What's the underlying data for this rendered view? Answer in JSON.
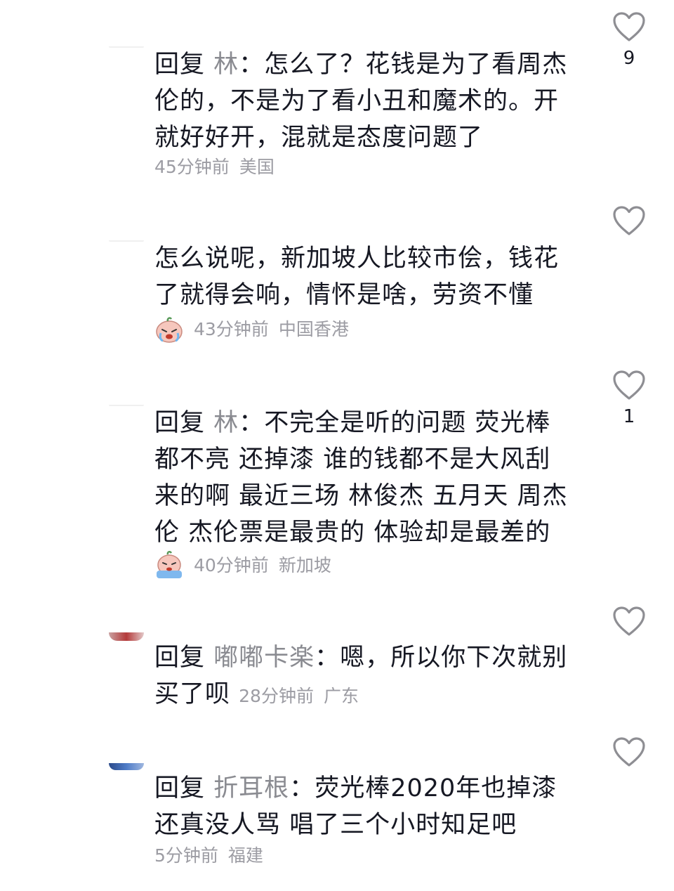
{
  "comments": [
    {
      "reply_word": "回复",
      "reply_to": "林",
      "colon": "：",
      "text": "怎么了？花钱是为了看周杰伦的，不是为了看小丑和魔术的。开就好好开，混就是态度问题了",
      "time": "45分钟前",
      "location": "美国",
      "likes": "9",
      "emoji": null
    },
    {
      "reply_word": "",
      "reply_to": "",
      "colon": "",
      "text": "怎么说呢，新加坡人比较市侩，钱花了就得会响，情怀是啥，劳资不懂",
      "time": "43分钟前",
      "location": "中国香港",
      "likes": "",
      "emoji": "crying-face-icon"
    },
    {
      "reply_word": "回复",
      "reply_to": "林",
      "colon": "：",
      "text": "不完全是听的问题 荧光棒都不亮 还掉漆  谁的钱都不是大风刮来的啊 最近三场 林俊杰 五月天 周杰伦 杰伦票是最贵的 体验却是最差的",
      "time": "40分钟前",
      "location": "新加坡",
      "likes": "1",
      "emoji": "sobbing-face-icon"
    },
    {
      "reply_word": "回复",
      "reply_to": "嘟嘟卡楽",
      "colon": "：",
      "text": "嗯，所以你下次就别买了呗",
      "time": "28分钟前",
      "location": "广东",
      "likes": "",
      "emoji": null
    },
    {
      "reply_word": "回复",
      "reply_to": "折耳根",
      "colon": "：",
      "text": "荧光棒2020年也掉漆还真没人骂 唱了三个小时知足吧",
      "time": "5分钟前",
      "location": "福建",
      "likes": "",
      "emoji": null
    }
  ],
  "icons": {
    "like": "heart-outline-icon"
  },
  "colors": {
    "text": "#161823",
    "muted": "#9c9ca3",
    "name": "#8a8b91"
  }
}
